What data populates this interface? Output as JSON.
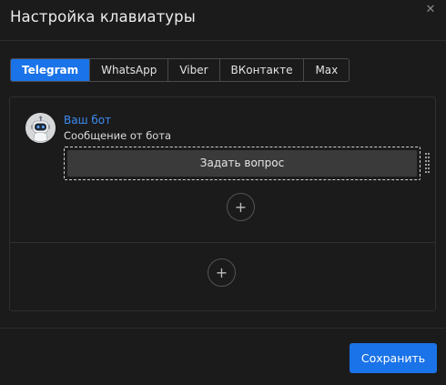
{
  "dialog": {
    "title": "Настройка клавиатуры",
    "close_icon": "close-icon"
  },
  "tabs": [
    {
      "label": "Telegram",
      "active": true
    },
    {
      "label": "WhatsApp",
      "active": false
    },
    {
      "label": "Viber",
      "active": false
    },
    {
      "label": "ВКонтакте",
      "active": false
    },
    {
      "label": "Max",
      "active": false
    }
  ],
  "message": {
    "sender": "Ваш бот",
    "text": "Сообщение от бота",
    "avatar_icon": "robot-icon"
  },
  "keyboard": {
    "buttons": [
      {
        "label": "Задать вопрос"
      }
    ],
    "add_button_icon": "plus-icon",
    "add_row_icon": "plus-icon",
    "drag_icon": "drag-handle-icon"
  },
  "footer": {
    "save_label": "Сохранить"
  },
  "colors": {
    "accent": "#1a73e8",
    "background": "#1b1b1c",
    "link": "#3d8cf0"
  }
}
